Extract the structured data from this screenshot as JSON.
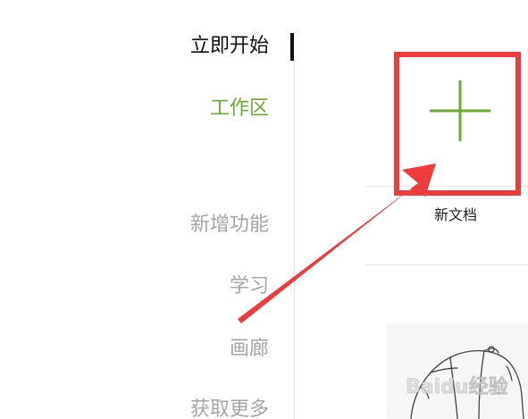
{
  "sidebar": {
    "items": [
      {
        "label": "立即开始",
        "state": "active"
      },
      {
        "label": "工作区",
        "state": "highlighted"
      },
      {
        "label": "新增功能",
        "state": "inactive"
      },
      {
        "label": "学习",
        "state": "inactive"
      },
      {
        "label": "画廊",
        "state": "inactive"
      },
      {
        "label": "获取更多",
        "state": "inactive"
      }
    ]
  },
  "main": {
    "new_document": {
      "label": "新文档",
      "icon": "plus-icon"
    },
    "thumbnail": {
      "icon": "cap-illustration"
    }
  },
  "annotation": {
    "highlight_color": "#ef3b3b",
    "arrow_color": "#ef3b3b"
  },
  "watermark": {
    "text": "Baidu经验"
  },
  "colors": {
    "accent_green": "#6aaa32",
    "active_text": "#111111",
    "inactive_text": "#a5a5a5"
  }
}
